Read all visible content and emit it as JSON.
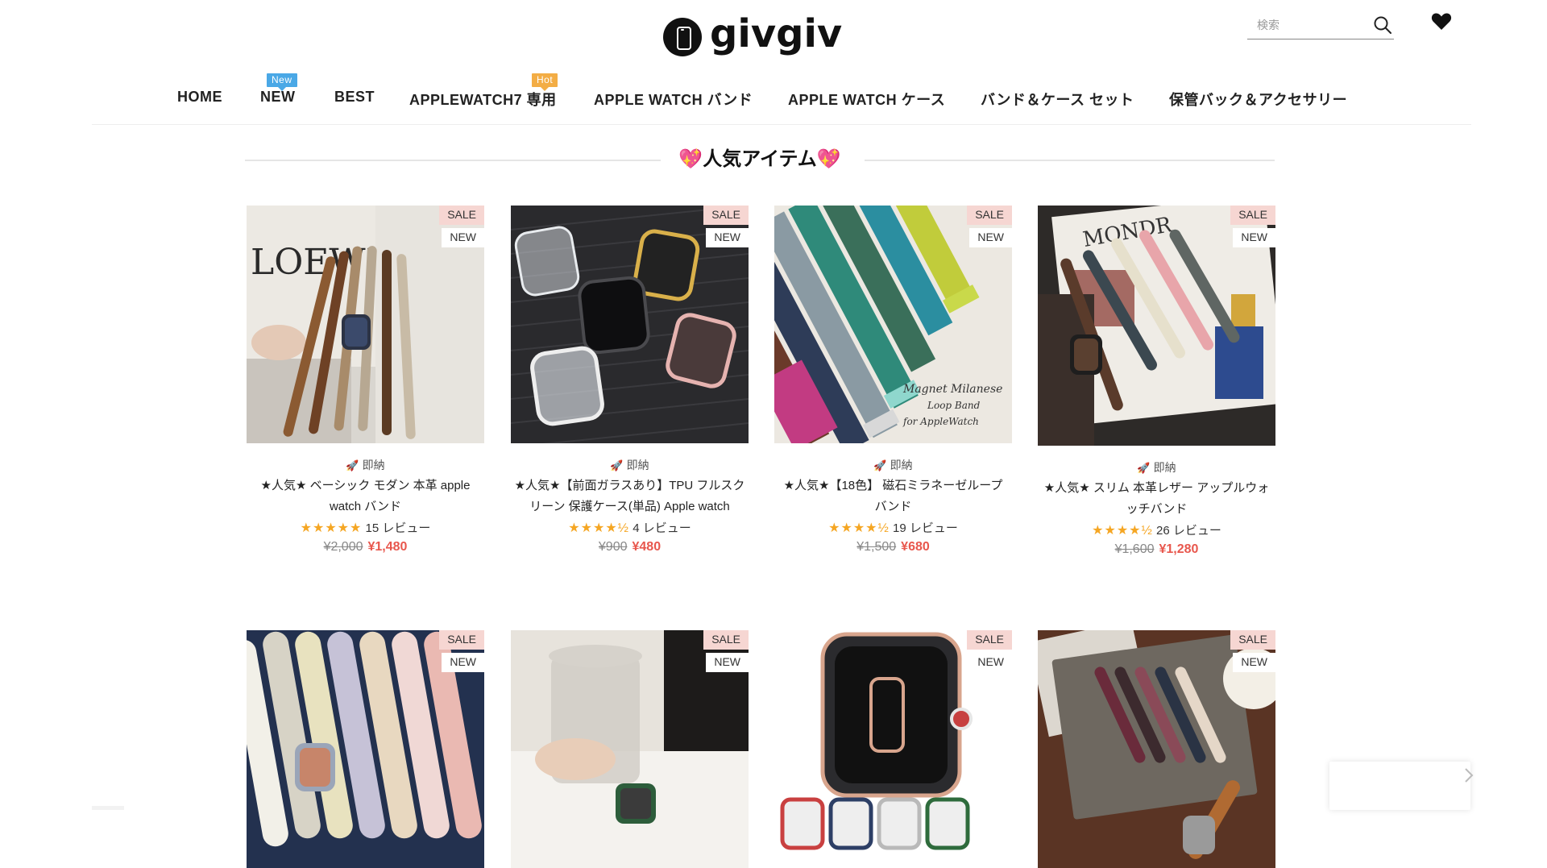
{
  "brand": {
    "name": "givgiv",
    "icon": "phone-logo-icon"
  },
  "search": {
    "placeholder": "検索",
    "icon": "search-icon"
  },
  "wishlist": {
    "icon": "heart-icon"
  },
  "nav": {
    "items": [
      {
        "label": "HOME"
      },
      {
        "label": "NEW",
        "badge": "New"
      },
      {
        "label": "BEST"
      },
      {
        "label": "APPLEWATCH7 専用",
        "badge": "Hot"
      },
      {
        "label": "APPLE WATCH バンド"
      },
      {
        "label": "APPLE WATCH ケース"
      },
      {
        "label": "バンド＆ケース セット"
      },
      {
        "label": "保管バック＆アクセサリー"
      }
    ],
    "badge_colors": {
      "new": "#4aa8e6",
      "hot": "#f3ad45"
    }
  },
  "section": {
    "title": "💖人気アイテム💖"
  },
  "products": [
    {
      "sale": "SALE",
      "new": "NEW",
      "delivery": "即納",
      "name": "★人気★ ベーシック モダン 本革 apple watch バンド",
      "stars": "★★★★★",
      "reviews": "15 レビュー",
      "price_old": "¥2,000",
      "price_new": "¥1,480",
      "image": "leather-bands-loewe-photo"
    },
    {
      "sale": "SALE",
      "new": "NEW",
      "delivery": "即納",
      "name": "★人気★【前面ガラスあり】TPU フルスクリーン 保護ケース(単品) Apple watch",
      "stars": "★★★★½",
      "reviews": "4 レビュー",
      "price_old": "¥900",
      "price_new": "¥480",
      "image": "tpu-cases-photo"
    },
    {
      "sale": "SALE",
      "new": "NEW",
      "delivery": "即納",
      "name": "★人気★【18色】 磁石ミラネーゼループバンド",
      "stars": "★★★★½",
      "reviews": "19 レビュー",
      "price_old": "¥1,500",
      "price_new": "¥680",
      "image": "milanese-loop-photo",
      "image_caption": [
        "Magnet Milanese",
        "Loop Band",
        "for AppleWatch"
      ]
    },
    {
      "sale": "SALE",
      "new": "NEW",
      "delivery": "即納",
      "name": "★人気★ スリム 本革レザー アップルウォッチバンド",
      "stars": "★★★★½",
      "reviews": "26 レビュー",
      "price_old": "¥1,600",
      "price_new": "¥1,280",
      "image": "slim-leather-bands-photo"
    },
    {
      "sale": "SALE",
      "new": "NEW",
      "image": "silicone-bands-photo"
    },
    {
      "sale": "SALE",
      "new": "NEW",
      "image": "green-band-coffee-photo"
    },
    {
      "sale": "SALE",
      "new": "NEW",
      "image": "glass-case-photo"
    },
    {
      "sale": "SALE",
      "new": "NEW",
      "image": "leather-bands-book-photo"
    }
  ],
  "colors": {
    "accent_price": "#e8574d",
    "star": "#f5a623",
    "sale_tag_bg": "#f6d6d2"
  }
}
